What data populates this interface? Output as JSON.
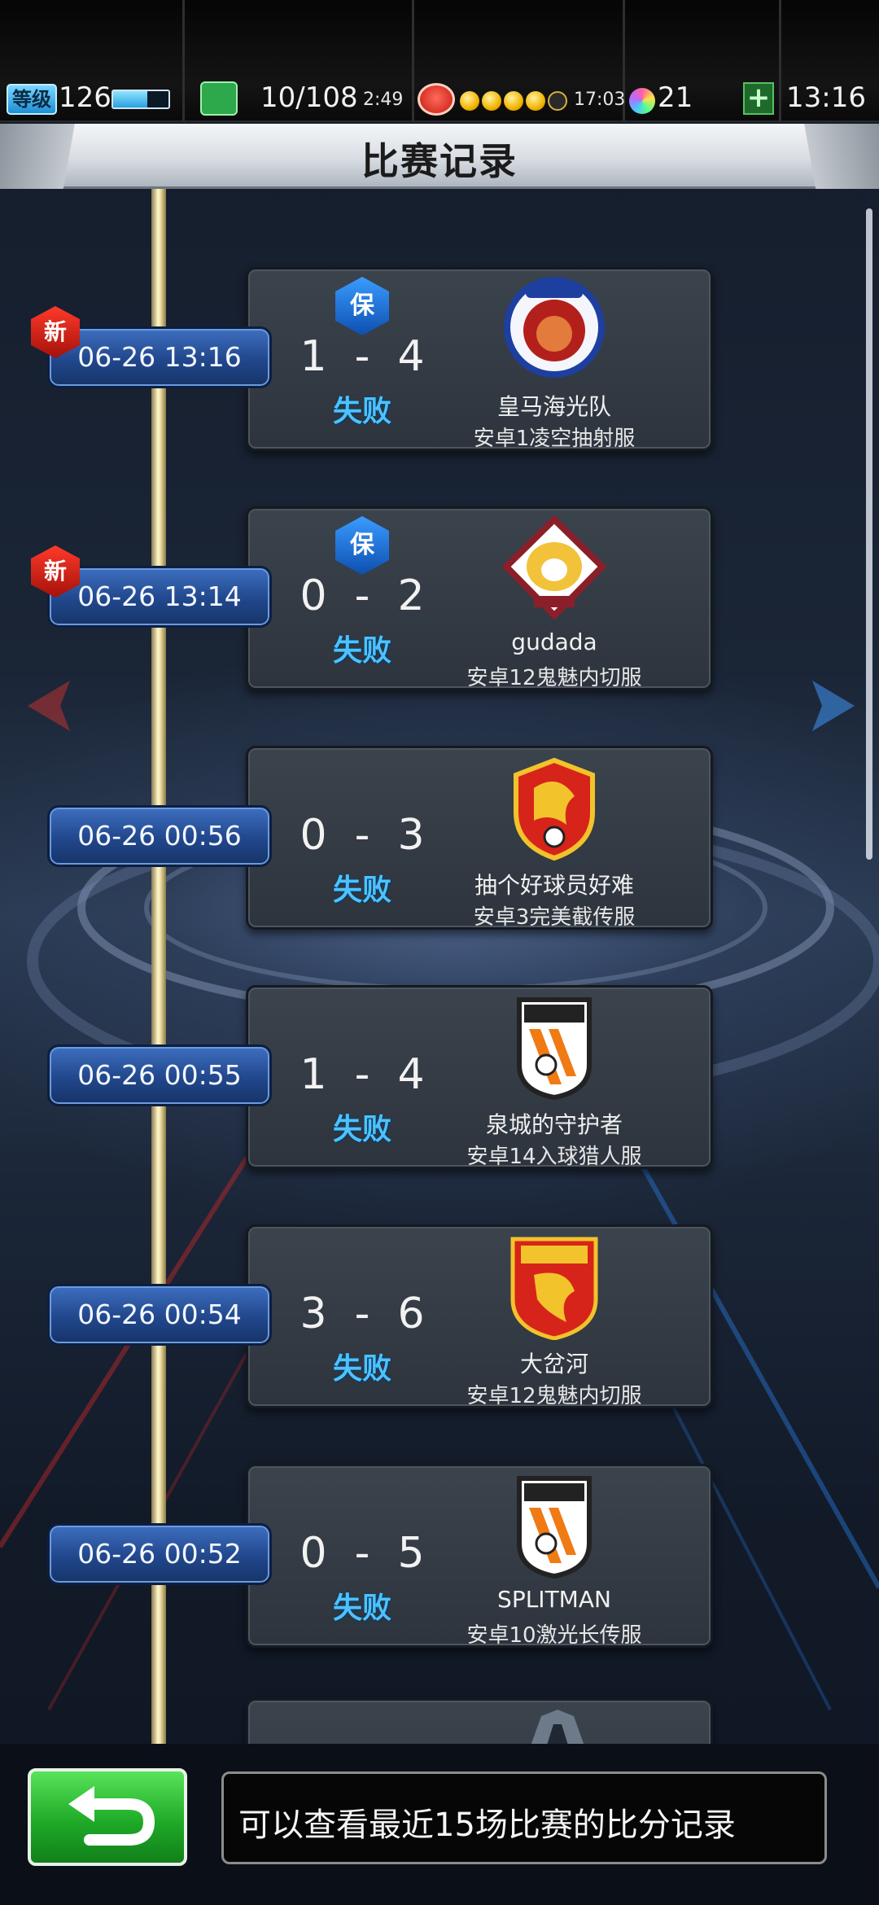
{
  "status_bar": {
    "level_label": "等级",
    "level_value": "126",
    "level_progress": 0.62,
    "stamina_value": "10/108",
    "stamina_timer": "2:49",
    "coins_filled": 4,
    "coins_total": 5,
    "coin_timer": "17:03",
    "gem_count": "21",
    "plus_label": "+",
    "clock": "13:16",
    "icons": [
      "level-badge",
      "stamina-icon",
      "coin-badge",
      "gem-icon",
      "plus-button"
    ]
  },
  "header": {
    "title": "比赛记录"
  },
  "records": [
    {
      "time": "06-26 13:16",
      "is_new": true,
      "new_label": "新",
      "protected": true,
      "protect_label": "保",
      "home_score": "1",
      "away_score": "4",
      "result": "失败",
      "crest": "lion",
      "team": "皇马海光队",
      "player": "安卓1凌空抽射服"
    },
    {
      "time": "06-26 13:14",
      "is_new": true,
      "new_label": "新",
      "protected": true,
      "protect_label": "保",
      "home_score": "0",
      "away_score": "2",
      "result": "失败",
      "crest": "tiger",
      "team": "gudada",
      "player": "安卓12鬼魅内切服"
    },
    {
      "time": "06-26 00:56",
      "is_new": false,
      "protected": false,
      "home_score": "0",
      "away_score": "3",
      "result": "失败",
      "crest": "red-shield",
      "team": "抽个好球员好难",
      "player": "安卓3完美截传服"
    },
    {
      "time": "06-26 00:55",
      "is_new": false,
      "protected": false,
      "home_score": "1",
      "away_score": "4",
      "result": "失败",
      "crest": "lnts",
      "team": "泉城的守护者",
      "player": "安卓14入球猎人服"
    },
    {
      "time": "06-26 00:54",
      "is_new": false,
      "protected": false,
      "home_score": "3",
      "away_score": "6",
      "result": "失败",
      "crest": "cffc",
      "team": "大岔河",
      "player": "安卓12鬼魅内切服"
    },
    {
      "time": "06-26 00:52",
      "is_new": false,
      "protected": false,
      "home_score": "0",
      "away_score": "5",
      "result": "失败",
      "crest": "lnts",
      "team": "SPLITMAN",
      "player": "安卓10激光长传服"
    }
  ],
  "footer": {
    "back_icon": "return-arrow-icon",
    "hint": "可以查看最近15场比赛的比分记录"
  },
  "colors": {
    "result_fail": "#4cc2ff",
    "back_button": "#1faa28",
    "time_pill": "#21478c"
  }
}
